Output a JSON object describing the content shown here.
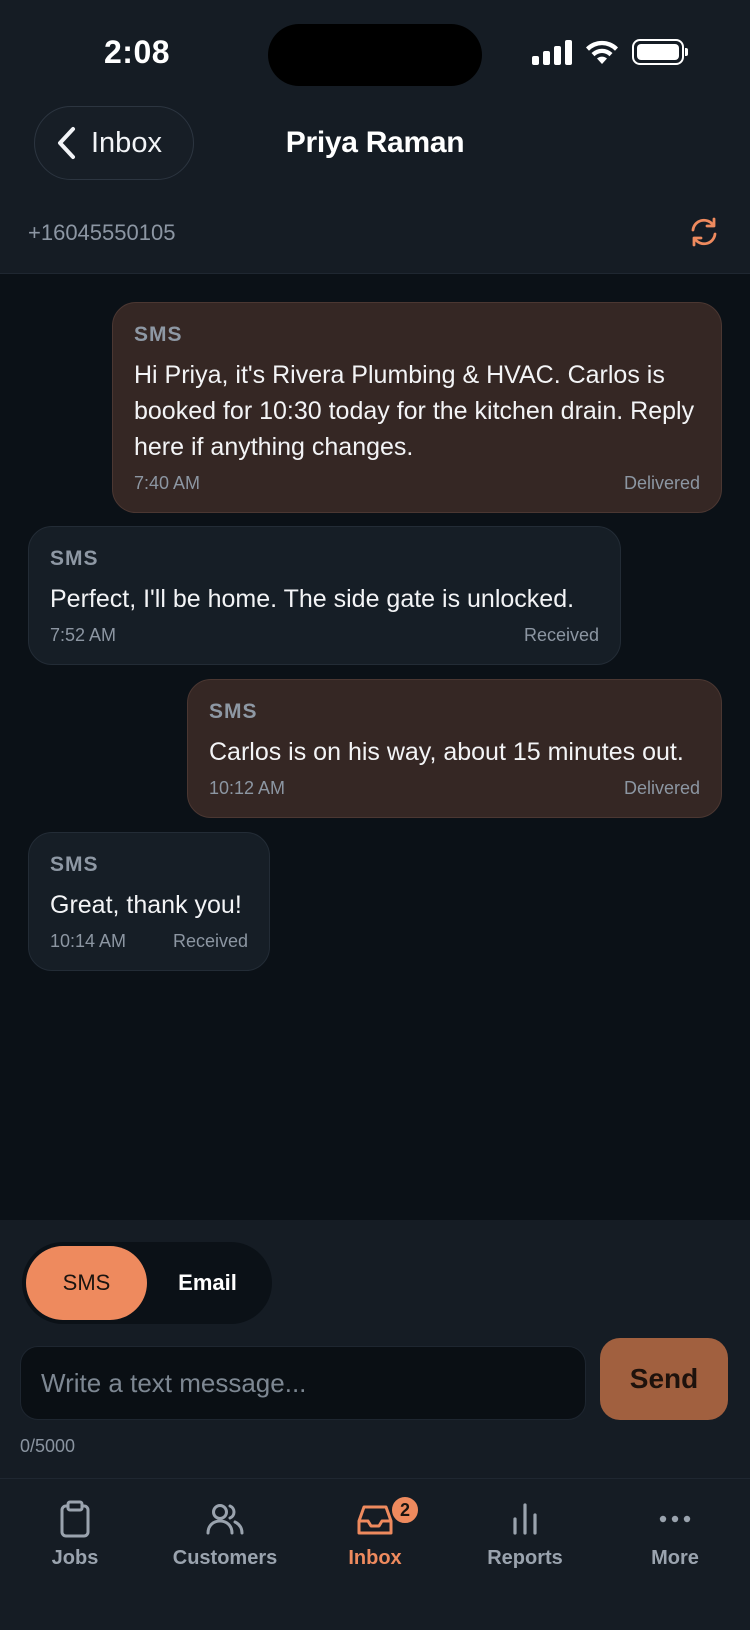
{
  "status_bar": {
    "time": "2:08"
  },
  "header": {
    "back_label": "Inbox",
    "title": "Priya Raman",
    "phone": "+16045550105"
  },
  "messages": [
    {
      "direction": "outgoing",
      "channel": "SMS",
      "text": "Hi Priya, it's Rivera Plumbing & HVAC. Carlos is booked for 10:30 today for the kitchen drain. Reply here if anything changes.",
      "time": "7:40 AM",
      "status": "Delivered"
    },
    {
      "direction": "incoming",
      "channel": "SMS",
      "text": "Perfect, I'll be home. The side gate is unlocked.",
      "time": "7:52 AM",
      "status": "Received"
    },
    {
      "direction": "outgoing",
      "channel": "SMS",
      "text": "Carlos is on his way, about 15 minutes out.",
      "time": "10:12 AM",
      "status": "Delivered"
    },
    {
      "direction": "incoming",
      "channel": "SMS",
      "text": "Great, thank you!",
      "time": "10:14 AM",
      "status": "Received"
    }
  ],
  "composer": {
    "channel_options": [
      "SMS",
      "Email"
    ],
    "selected_channel": "SMS",
    "placeholder": "Write a text message...",
    "value": "",
    "send_label": "Send",
    "counter": "0/5000"
  },
  "tabbar": {
    "tabs": [
      {
        "label": "Jobs",
        "icon": "clipboard-icon"
      },
      {
        "label": "Customers",
        "icon": "users-icon"
      },
      {
        "label": "Inbox",
        "icon": "inbox-icon",
        "badge": "2"
      },
      {
        "label": "Reports",
        "icon": "bar-chart-icon"
      },
      {
        "label": "More",
        "icon": "more-icon"
      }
    ],
    "active": "Inbox"
  },
  "colors": {
    "accent": "#ee8a5e",
    "background": "#0b1117",
    "surface": "#151c24",
    "outgoing_bubble": "#352724",
    "incoming_bubble": "#161e26"
  }
}
